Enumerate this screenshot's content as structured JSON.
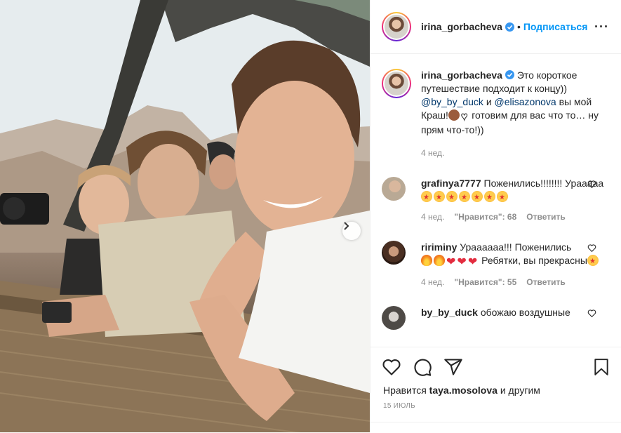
{
  "header": {
    "username": "irina_gorbacheva",
    "separator": "•",
    "follow_label": "Подписаться",
    "more_label": "···"
  },
  "caption": {
    "username": "irina_gorbacheva",
    "text_1": "Это короткое путешествие подходит к концу)) ",
    "mention_1": "@by_by_duck",
    "text_2": " и ",
    "mention_2": "@elisazonova",
    "text_3": " вы мой Краш!",
    "text_4": " готовим для вас что то… ну прям что-то!))",
    "time": "4 нед."
  },
  "comments": [
    {
      "username": "grafinya7777",
      "text": "Поженились!!!!!!!! Урааааа",
      "time": "4 нед.",
      "likes": "\"Нравится\": 68",
      "reply": "Ответить"
    },
    {
      "username": "ririminy",
      "text": "Ураааааа!!! Поженились",
      "text_2": " Ребятки, вы прекрасны",
      "time": "4 нед.",
      "likes": "\"Нравится\": 55",
      "reply": "Ответить"
    },
    {
      "username": "by_by_duck",
      "text": "обожаю воздушные"
    }
  ],
  "actions": {
    "likes_prefix": "Нравится ",
    "likes_user": "taya.mosolova",
    "likes_suffix": " и другим",
    "date": "15 июль"
  },
  "colors": {
    "accent": "#0095f6",
    "mention": "#00376b",
    "muted": "#8e8e8e",
    "text": "#262626",
    "border": "#efefef"
  },
  "icons": [
    "verified-icon",
    "heart-icon",
    "comment-icon",
    "share-icon",
    "save-icon",
    "chevron-right-icon",
    "heart-outline-small-icon"
  ]
}
